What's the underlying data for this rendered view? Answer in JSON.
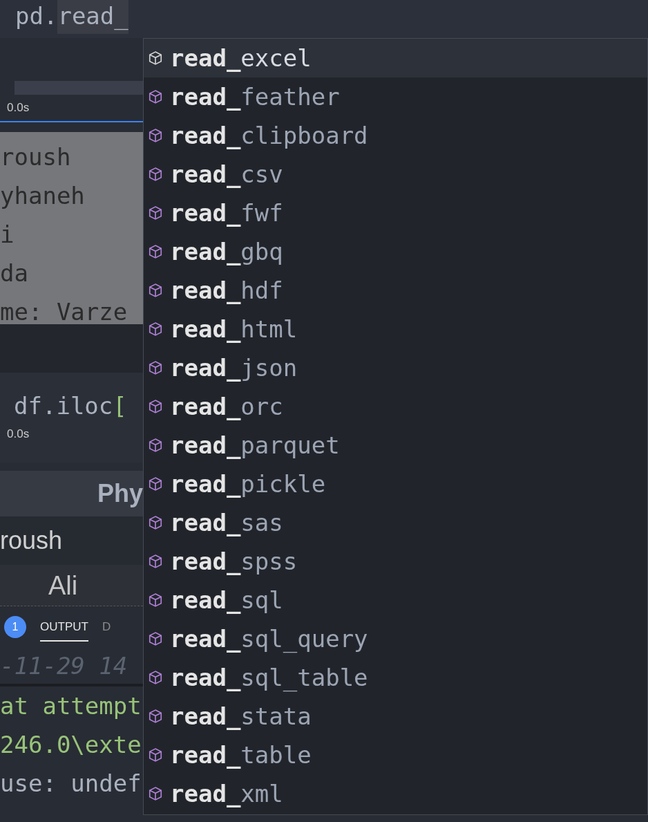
{
  "notebook": {
    "input_cell": {
      "prefix": "pd.",
      "typed": "read_"
    },
    "duration_1": "0.0s",
    "output_lines": [
      "roush",
      "yhaneh",
      "i",
      "da",
      "me: Varze"
    ],
    "second_cell": {
      "code": "df.iloc",
      "bracket": "["
    },
    "duration_2": "0.0s",
    "table": {
      "header": "Phy",
      "row_1": "roush",
      "row_2": "Ali"
    }
  },
  "panel": {
    "badge": "1",
    "tabs": [
      {
        "label": "OUTPUT",
        "selected": true
      },
      {
        "label": "D",
        "selected": false
      }
    ],
    "log_lines": [
      {
        "text": "-11-29 14",
        "kind": "timestamp"
      },
      {
        "text": "at attempt",
        "kind": "string"
      },
      {
        "text": "246.0\\exte",
        "kind": "string"
      },
      {
        "text": "use: undef",
        "kind": "plain"
      }
    ]
  },
  "suggestions": [
    {
      "label": "**read_**excel",
      "selected": true
    },
    {
      "label": "**read_**feather",
      "selected": false
    },
    {
      "label": "**read_**clipboard",
      "selected": false
    },
    {
      "label": "**read_**csv",
      "selected": false
    },
    {
      "label": "**read_**fwf",
      "selected": false
    },
    {
      "label": "**read_**gbq",
      "selected": false
    },
    {
      "label": "**read_**hdf",
      "selected": false
    },
    {
      "label": "**read_**html",
      "selected": false
    },
    {
      "label": "**read_**json",
      "selected": false
    },
    {
      "label": "**read_**orc",
      "selected": false
    },
    {
      "label": "**read_**parquet",
      "selected": false
    },
    {
      "label": "**read_**pickle",
      "selected": false
    },
    {
      "label": "**read_**sas",
      "selected": false
    },
    {
      "label": "**read_**spss",
      "selected": false
    },
    {
      "label": "**read_**sql",
      "selected": false
    },
    {
      "label": "**read_**sql_query",
      "selected": false
    },
    {
      "label": "**read_**sql_table",
      "selected": false
    },
    {
      "label": "**read_**stata",
      "selected": false
    },
    {
      "label": "**read_**table",
      "selected": false
    },
    {
      "label": "**read_**xml",
      "selected": false
    }
  ]
}
